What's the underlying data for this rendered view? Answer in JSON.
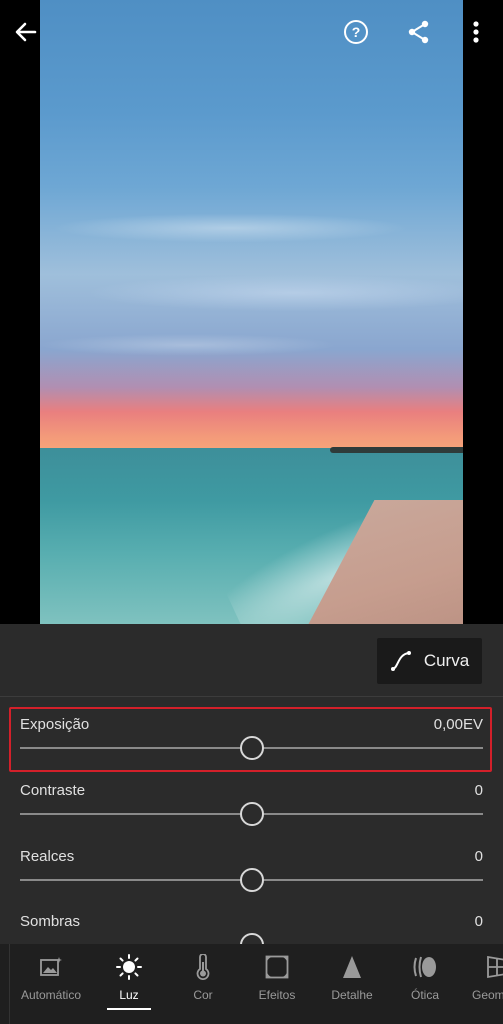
{
  "topbar": {
    "back_icon": "arrow-left-icon",
    "help_icon": "question-circle-icon",
    "share_icon": "share-icon",
    "more_icon": "more-vertical-icon"
  },
  "panel": {
    "curve_button_label": "Curva",
    "sliders": [
      {
        "name": "Exposição",
        "value": "0,00EV",
        "level": 0.5
      },
      {
        "name": "Contraste",
        "value": "0",
        "level": 0.5
      },
      {
        "name": "Realces",
        "value": "0",
        "level": 0.5
      },
      {
        "name": "Sombras",
        "value": "0",
        "level": 0.5
      }
    ],
    "highlight_color": "#d3202a"
  },
  "toolbar": {
    "items": [
      {
        "label": "Automático",
        "icon": "auto-image-icon"
      },
      {
        "label": "Luz",
        "icon": "sun-icon",
        "active": true
      },
      {
        "label": "Cor",
        "icon": "thermometer-icon"
      },
      {
        "label": "Efeitos",
        "icon": "vignette-icon"
      },
      {
        "label": "Detalhe",
        "icon": "triangle-icon"
      },
      {
        "label": "Ótica",
        "icon": "lens-icon"
      },
      {
        "label": "Geom",
        "icon": "geometry-icon"
      }
    ]
  }
}
